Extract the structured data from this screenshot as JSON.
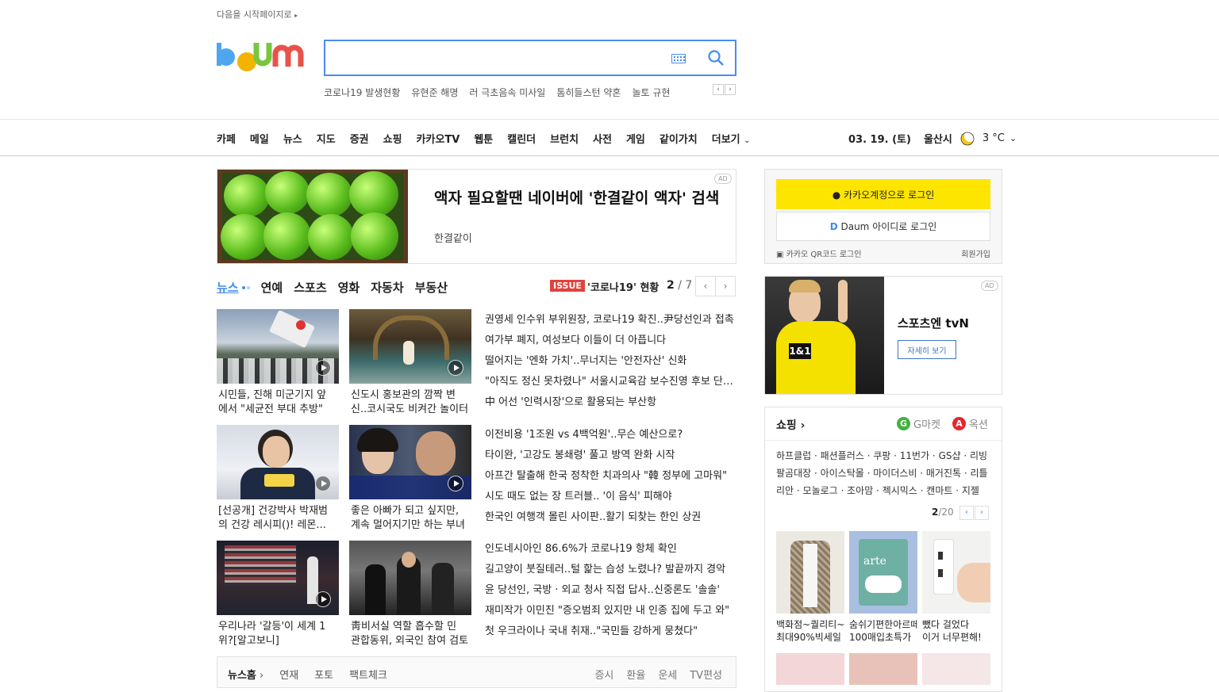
{
  "header": {
    "start_home": "다음을 시작페이지로",
    "search_placeholder": "",
    "trending": [
      "코로나19 발생현황",
      "유현준 해명",
      "러 극초음속 미사일",
      "톰히들스턴 약혼",
      "놀토 규현"
    ]
  },
  "gnb": {
    "items": [
      "카페",
      "메일",
      "뉴스",
      "지도",
      "증권",
      "쇼핑",
      "카카오TV",
      "웹툰",
      "캘린더",
      "브런치",
      "사전",
      "게임",
      "같이가치",
      "더보기"
    ],
    "date": "03. 19. (토)",
    "city": "울산시",
    "temp": "3 °C"
  },
  "ad_banner": {
    "title": "액자 필요할땐 네이버에 '한결같이 액자' 검색",
    "brand": "한결같이",
    "badge": "AD"
  },
  "news": {
    "tabs": [
      "뉴스",
      "연예",
      "스포츠",
      "영화",
      "자동차",
      "부동산"
    ],
    "issue_badge": "ISSUE",
    "issue_title": "'코로나19' 현황",
    "issue_page_current": "2",
    "issue_page_total": "7",
    "thumbs": [
      {
        "line1": "시민들, 진해 미군기지 앞",
        "line2": "에서 \"세균전 부대 추방\""
      },
      {
        "line1": "신도시 홍보관의 깜짝 변",
        "line2": "신..코시국도 비켜간 놀이터"
      },
      {
        "line1": "[선공개] 건강박사 박재범",
        "line2": "의 건강 레시피()! 레몬..."
      },
      {
        "line1": "좋은 아빠가 되고 싶지만,",
        "line2": "계속 멀어지기만 하는 부녀"
      },
      {
        "line1": "우리나라 '갈등'이 세계 1",
        "line2": "위?[알고보니]"
      },
      {
        "line1": "靑비서실 역할 흡수할 민",
        "line2": "관합동위, 외국인 참여 검토"
      }
    ],
    "headlines_1": [
      "권영세 인수위 부위원장, 코로나19 확진..尹당선인과 접촉",
      "여가부 폐지, 여성보다 이들이 더 아픕니다",
      "떨어지는 '엔화 가치'..무너지는 '안전자산' 신화",
      "\"아직도 정신 못차렸나\" 서울시교육감 보수진영 후보 단일화",
      "中 어선 '인력시장'으로 활용되는 부산항"
    ],
    "headlines_2": [
      "이전비용 '1조원 vs 4백억원'..무슨 예산으로?",
      "타이완, '고강도 봉쇄령' 풀고 방역 완화 시작",
      "아프간 탈출해 한국 정착한 치과의사 \"韓 정부에 고마워\"",
      "시도 때도 없는 장 트러블.. '이 음식' 피해야",
      "한국인 여행객 몰린 사이판..활기 되찾는 한인 상권"
    ],
    "headlines_3": [
      "인도네시아인 86.6%가 코로나19 항체 확인",
      "길고양이 붓질테러..털 핥는 습성 노렸나? 발끝까지 경악",
      "윤 당선인, 국방 · 외교 청사 직접 답사..신중론도 '솔솔'",
      "재미작가 이민진 \"증오범죄 있지만 내 인종 집에 두고 와\"",
      "첫 우크라이나 국내 취재..\"국민들 강하게 뭉쳤다\""
    ],
    "footer_left": [
      "뉴스홈",
      "연재",
      "포토",
      "팩트체크"
    ],
    "footer_right": [
      "증시",
      "환율",
      "운세",
      "TV편성"
    ]
  },
  "login": {
    "kakao": "카카오계정으로 로그인",
    "daum": "Daum 아이디로 로그인",
    "qr": "카카오 QR코드 로그인",
    "signup": "회원가입"
  },
  "side_ad": {
    "title": "스포츠엔 tvN",
    "button": "자세히 보기",
    "badge": "AD"
  },
  "shopping": {
    "title": "쇼핑",
    "gmarket": "G마켓",
    "auction": "옥션",
    "links": "하프클럽 · 패션플러스 · 쿠팡 · 11번가 · GS샵 · 리빙팔곰대장 · 아이스탁몰 · 마이더스비 · 매거진톡 · 리틀리안 · 모놀로그 · 조아맘 · 젝시믹스 · 캔마트 · 지젤",
    "page_current": "2",
    "page_total": "20",
    "items": [
      {
        "line1": "백화점~퀄리티~",
        "line2": "최대90%빅세일"
      },
      {
        "line1": "숨쉬기편한아르떼",
        "line2": "100매입초특가"
      },
      {
        "line1": "뺐다 걸었다",
        "line2": "이거 너무편해!"
      }
    ]
  }
}
